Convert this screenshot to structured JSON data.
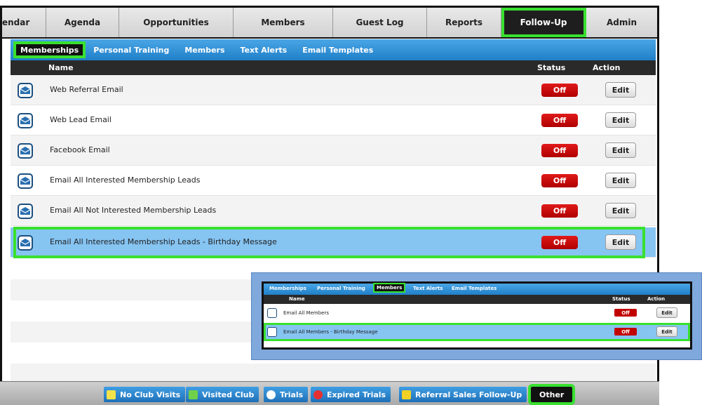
{
  "topnav": {
    "tabs": [
      {
        "label": "endar"
      },
      {
        "label": "Agenda"
      },
      {
        "label": "Opportunities"
      },
      {
        "label": "Members"
      },
      {
        "label": "Guest Log"
      },
      {
        "label": "Reports"
      },
      {
        "label": "Follow-Up",
        "active": true
      },
      {
        "label": "Admin"
      }
    ]
  },
  "subnav": {
    "items": [
      {
        "label": "Memberships",
        "active": true
      },
      {
        "label": "Personal Training"
      },
      {
        "label": "Members"
      },
      {
        "label": "Text Alerts"
      },
      {
        "label": "Email Templates"
      }
    ]
  },
  "table": {
    "headers": {
      "name": "Name",
      "status": "Status",
      "action": "Action"
    },
    "rows": [
      {
        "name": "Web Referral Email",
        "status": "Off",
        "action": "Edit"
      },
      {
        "name": "Web Lead Email",
        "status": "Off",
        "action": "Edit"
      },
      {
        "name": "Facebook Email",
        "status": "Off",
        "action": "Edit"
      },
      {
        "name": "Email All Interested Membership Leads",
        "status": "Off",
        "action": "Edit"
      },
      {
        "name": "Email All Not Interested Membership Leads",
        "status": "Off",
        "action": "Edit"
      },
      {
        "name": "Email All Interested Membership Leads - Birthday Message",
        "status": "Off",
        "action": "Edit",
        "selected": true
      }
    ]
  },
  "bottombar": {
    "buttons": [
      {
        "label": "No Club Visits",
        "icon": "card-icon"
      },
      {
        "label": "Visited Club",
        "icon": "card-check-icon"
      },
      {
        "label": "Trials",
        "icon": "arrow-up-icon"
      },
      {
        "label": "Expired Trials",
        "icon": "arrow-up-red-icon"
      },
      {
        "label": "Referral Sales Follow-Up",
        "icon": "trophy-icon"
      },
      {
        "label": "Other",
        "active": true
      }
    ]
  },
  "inset": {
    "subnav": [
      "Memberships",
      "Personal Training",
      "Members",
      "Text Alerts",
      "Email Templates"
    ],
    "active_sub": "Members",
    "headers": {
      "name": "Name",
      "status": "Status",
      "action": "Action"
    },
    "rows": [
      {
        "name": "Email All Members",
        "status": "Off",
        "action": "Edit"
      },
      {
        "name": "Email All Members - Birthday Message",
        "status": "Off",
        "action": "Edit",
        "selected": true
      }
    ]
  },
  "colors": {
    "highlight": "#39e02f",
    "status_off": "#c10000",
    "subnav_blue": "#2b8fd6",
    "selected_row": "#86c4f2"
  }
}
